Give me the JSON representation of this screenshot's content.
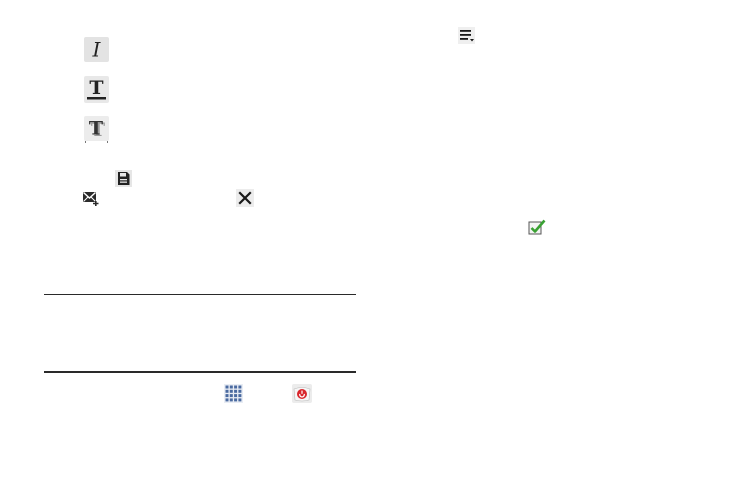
{
  "icons": {
    "italic": "italic-icon",
    "underline": "underline-icon",
    "shadow": "text-shadow-icon",
    "save": "save-icon",
    "email_attachment": "email-attachment-icon",
    "close": "close-icon",
    "list_menu": "list-menu-icon",
    "checkbox_checked": "checkbox-checked-icon",
    "apps_grid": "apps-grid-icon",
    "app_launcher": "app-icon"
  },
  "colors": {
    "check_green": "#3aa133",
    "apps_grid_blue": "#4a6aa0",
    "app_icon_red": "#d9262c"
  }
}
